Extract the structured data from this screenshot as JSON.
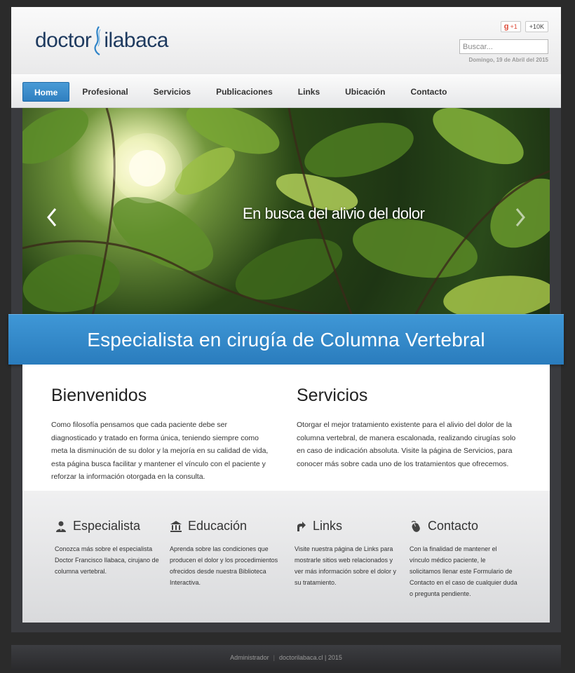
{
  "header": {
    "logo_left": "doctor",
    "logo_right": "ilabaca",
    "gplus_label": "+1",
    "gplus_count": "+10K",
    "search_placeholder": "Buscar...",
    "date": "Domingo, 19 de Abril del 2015"
  },
  "nav": {
    "items": [
      "Home",
      "Profesional",
      "Servicios",
      "Publicaciones",
      "Links",
      "Ubicación",
      "Contacto"
    ],
    "active": "Home"
  },
  "slider": {
    "caption": "En busca del alivio del dolor",
    "prev_icon": "chevron-left-icon",
    "next_icon": "chevron-right-icon"
  },
  "banner": {
    "text": "Especialista en cirugía de Columna Vertebral"
  },
  "welcome": {
    "title": "Bienvenidos",
    "text": "Como filosofía pensamos que cada paciente debe ser diagnosticado y tratado en forma única, teniendo siempre como meta la disminución de su dolor y la mejoría en su calidad de vida, esta página busca facilitar y mantener el vínculo con el paciente y reforzar la información otorgada en la consulta."
  },
  "services": {
    "title": "Servicios",
    "text": "Otorgar el mejor tratamiento existente para el alivio del dolor de la columna vertebral, de manera escalonada, realizando cirugías solo en caso de indicación absoluta. Visite la página de Servicios, para conocer más sobre cada uno de los tratamientos que ofrecemos."
  },
  "features": [
    {
      "title": "Especialista",
      "icon": "person-icon",
      "text": "Conozca más sobre el especialista Doctor Francisco Ilabaca, cirujano de columna vertebral."
    },
    {
      "title": "Educación",
      "icon": "building-icon",
      "text": "Aprenda sobre las condiciones que producen el dolor y los procedimientos ofrecidos desde nuestra Biblioteca Interactiva."
    },
    {
      "title": "Links",
      "icon": "arrow-icon",
      "text": "Visite nuestra página de Links para mostrarle sitios web relacionados y ver más información sobre el dolor y su tratamiento."
    },
    {
      "title": "Contacto",
      "icon": "mouse-icon",
      "text": "Con la finalidad de mantener el vínculo médico paciente, le solicitamos llenar este Formulario de Contacto en el caso de cualquier duda o pregunta pendiente."
    }
  ],
  "footer": {
    "admin": "Administrador",
    "site": "doctorilabaca.cl | 2015"
  },
  "colors": {
    "accent": "#2f7fc0",
    "dark": "#3a3b3f"
  }
}
